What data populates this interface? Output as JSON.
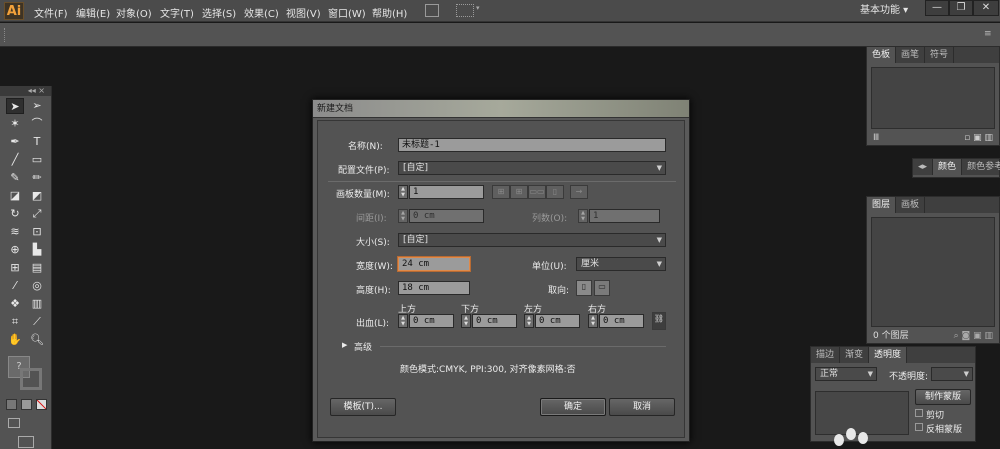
{
  "app": {
    "logo": "Ai"
  },
  "menu": [
    "文件(F)",
    "编辑(E)",
    "对象(O)",
    "文字(T)",
    "选择(S)",
    "效果(C)",
    "视图(V)",
    "窗口(W)",
    "帮助(H)"
  ],
  "workspace": {
    "label": "基本功能"
  },
  "window_controls": {
    "minimize": "—",
    "restore": "❐",
    "close": "✕"
  },
  "toolbox": {
    "header": "◂◂  ×"
  },
  "panels": {
    "swatches": {
      "tabs": [
        "色板",
        "画笔",
        "符号"
      ]
    },
    "color": {
      "tabs": [
        "颜色",
        "颜色参考"
      ]
    },
    "layers": {
      "tabs": [
        "图层",
        "画板"
      ],
      "footer": "0 个图层"
    },
    "transparency": {
      "tabs": [
        "描边",
        "渐变",
        "透明度"
      ],
      "blend_mode": "正常",
      "opacity_label": "不透明度:",
      "make_mask": "制作蒙版",
      "clip": "剪切",
      "invert_mask": "反相蒙版"
    }
  },
  "dialog": {
    "title": "新建文档",
    "name_label": "名称(N):",
    "name_value": "未标题-1",
    "profile_label": "配置文件(P):",
    "profile_value": "[自定]",
    "artboards_label": "画板数量(M):",
    "artboards_value": "1",
    "spacing_label": "间距(I):",
    "spacing_value": "0 cm",
    "columns_label": "列数(O):",
    "columns_value": "1",
    "size_label": "大小(S):",
    "size_value": "[自定]",
    "width_label": "宽度(W):",
    "width_value": "24 cm",
    "units_label": "单位(U):",
    "units_value": "厘米",
    "height_label": "高度(H):",
    "height_value": "18 cm",
    "orientation_label": "取向:",
    "bleed_label": "出血(L):",
    "bleed_top_label": "上方",
    "bleed_bottom_label": "下方",
    "bleed_left_label": "左方",
    "bleed_right_label": "右方",
    "bleed_top": "0 cm",
    "bleed_bottom": "0 cm",
    "bleed_left": "0 cm",
    "bleed_right": "0 cm",
    "advanced_label": "高级",
    "info": "颜色模式:CMYK, PPI:300, 对齐像素网格:否",
    "templates_button": "模板(T)...",
    "ok_button": "确定",
    "cancel_button": "取消"
  }
}
